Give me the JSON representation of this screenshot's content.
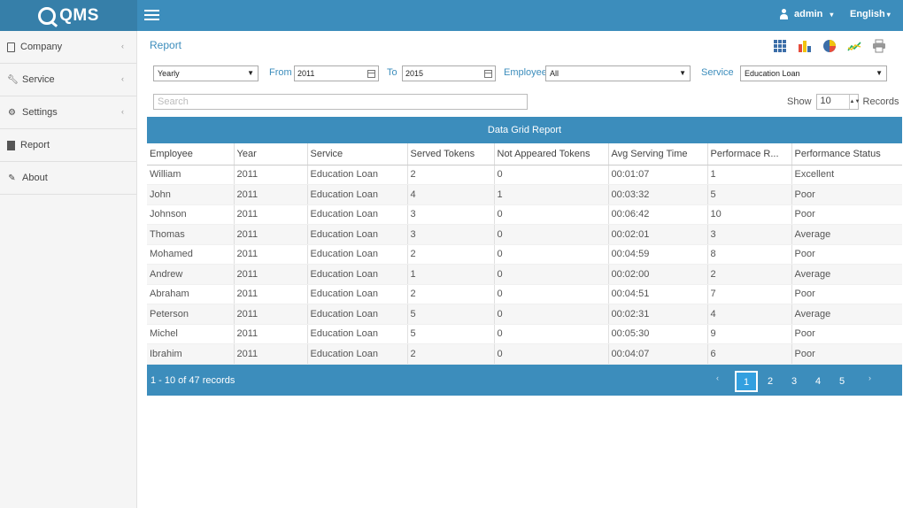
{
  "app": {
    "logo_text": "QMS"
  },
  "header": {
    "user": "admin",
    "language": "English"
  },
  "sidebar": {
    "items": [
      {
        "label": "Company",
        "icon": "building-icon",
        "has_children": true
      },
      {
        "label": "Service",
        "icon": "wrench-icon",
        "has_children": true
      },
      {
        "label": "Settings",
        "icon": "gear-icon",
        "has_children": true
      },
      {
        "label": "Report",
        "icon": "document-icon",
        "has_children": false
      },
      {
        "label": "About",
        "icon": "edit-icon",
        "has_children": false
      }
    ]
  },
  "page": {
    "title": "Report"
  },
  "toolbar": {
    "icons": [
      "grid-icon",
      "bar-chart-icon",
      "pie-chart-icon",
      "line-chart-icon",
      "print-icon"
    ],
    "colors": {
      "accent": "#3c8dbc",
      "header_dark": "#367fa9"
    }
  },
  "filters": {
    "period": "Yearly",
    "from_label": "From",
    "from_value": "2011",
    "to_label": "To",
    "to_value": "2015",
    "employee_label": "Employee",
    "employee_value": "All",
    "service_label": "Service",
    "service_value": "Education Loan"
  },
  "search": {
    "placeholder": "Search"
  },
  "show": {
    "label": "Show",
    "value": "10",
    "suffix": "Records"
  },
  "grid": {
    "title": "Data Grid Report",
    "columns": [
      "Employee",
      "Year",
      "Service",
      "Served Tokens",
      "Not Appeared Tokens",
      "Avg Serving Time",
      "Performace R...",
      "Performance Status"
    ],
    "rows": [
      [
        "William",
        "2011",
        "Education Loan",
        "2",
        "0",
        "00:01:07",
        "1",
        "Excellent"
      ],
      [
        "John",
        "2011",
        "Education Loan",
        "4",
        "1",
        "00:03:32",
        "5",
        "Poor"
      ],
      [
        "Johnson",
        "2011",
        "Education Loan",
        "3",
        "0",
        "00:06:42",
        "10",
        "Poor"
      ],
      [
        "Thomas",
        "2011",
        "Education Loan",
        "3",
        "0",
        "00:02:01",
        "3",
        "Average"
      ],
      [
        "Mohamed",
        "2011",
        "Education Loan",
        "2",
        "0",
        "00:04:59",
        "8",
        "Poor"
      ],
      [
        "Andrew",
        "2011",
        "Education Loan",
        "1",
        "0",
        "00:02:00",
        "2",
        "Average"
      ],
      [
        "Abraham",
        "2011",
        "Education Loan",
        "2",
        "0",
        "00:04:51",
        "7",
        "Poor"
      ],
      [
        "Peterson",
        "2011",
        "Education Loan",
        "5",
        "0",
        "00:02:31",
        "4",
        "Average"
      ],
      [
        "Michel",
        "2011",
        "Education Loan",
        "5",
        "0",
        "00:05:30",
        "9",
        "Poor"
      ],
      [
        "Ibrahim",
        "2011",
        "Education Loan",
        "2",
        "0",
        "00:04:07",
        "6",
        "Poor"
      ]
    ],
    "pager": {
      "info": "1 - 10 of 47 records",
      "pages": [
        "1",
        "2",
        "3",
        "4",
        "5"
      ],
      "current": "1"
    }
  }
}
